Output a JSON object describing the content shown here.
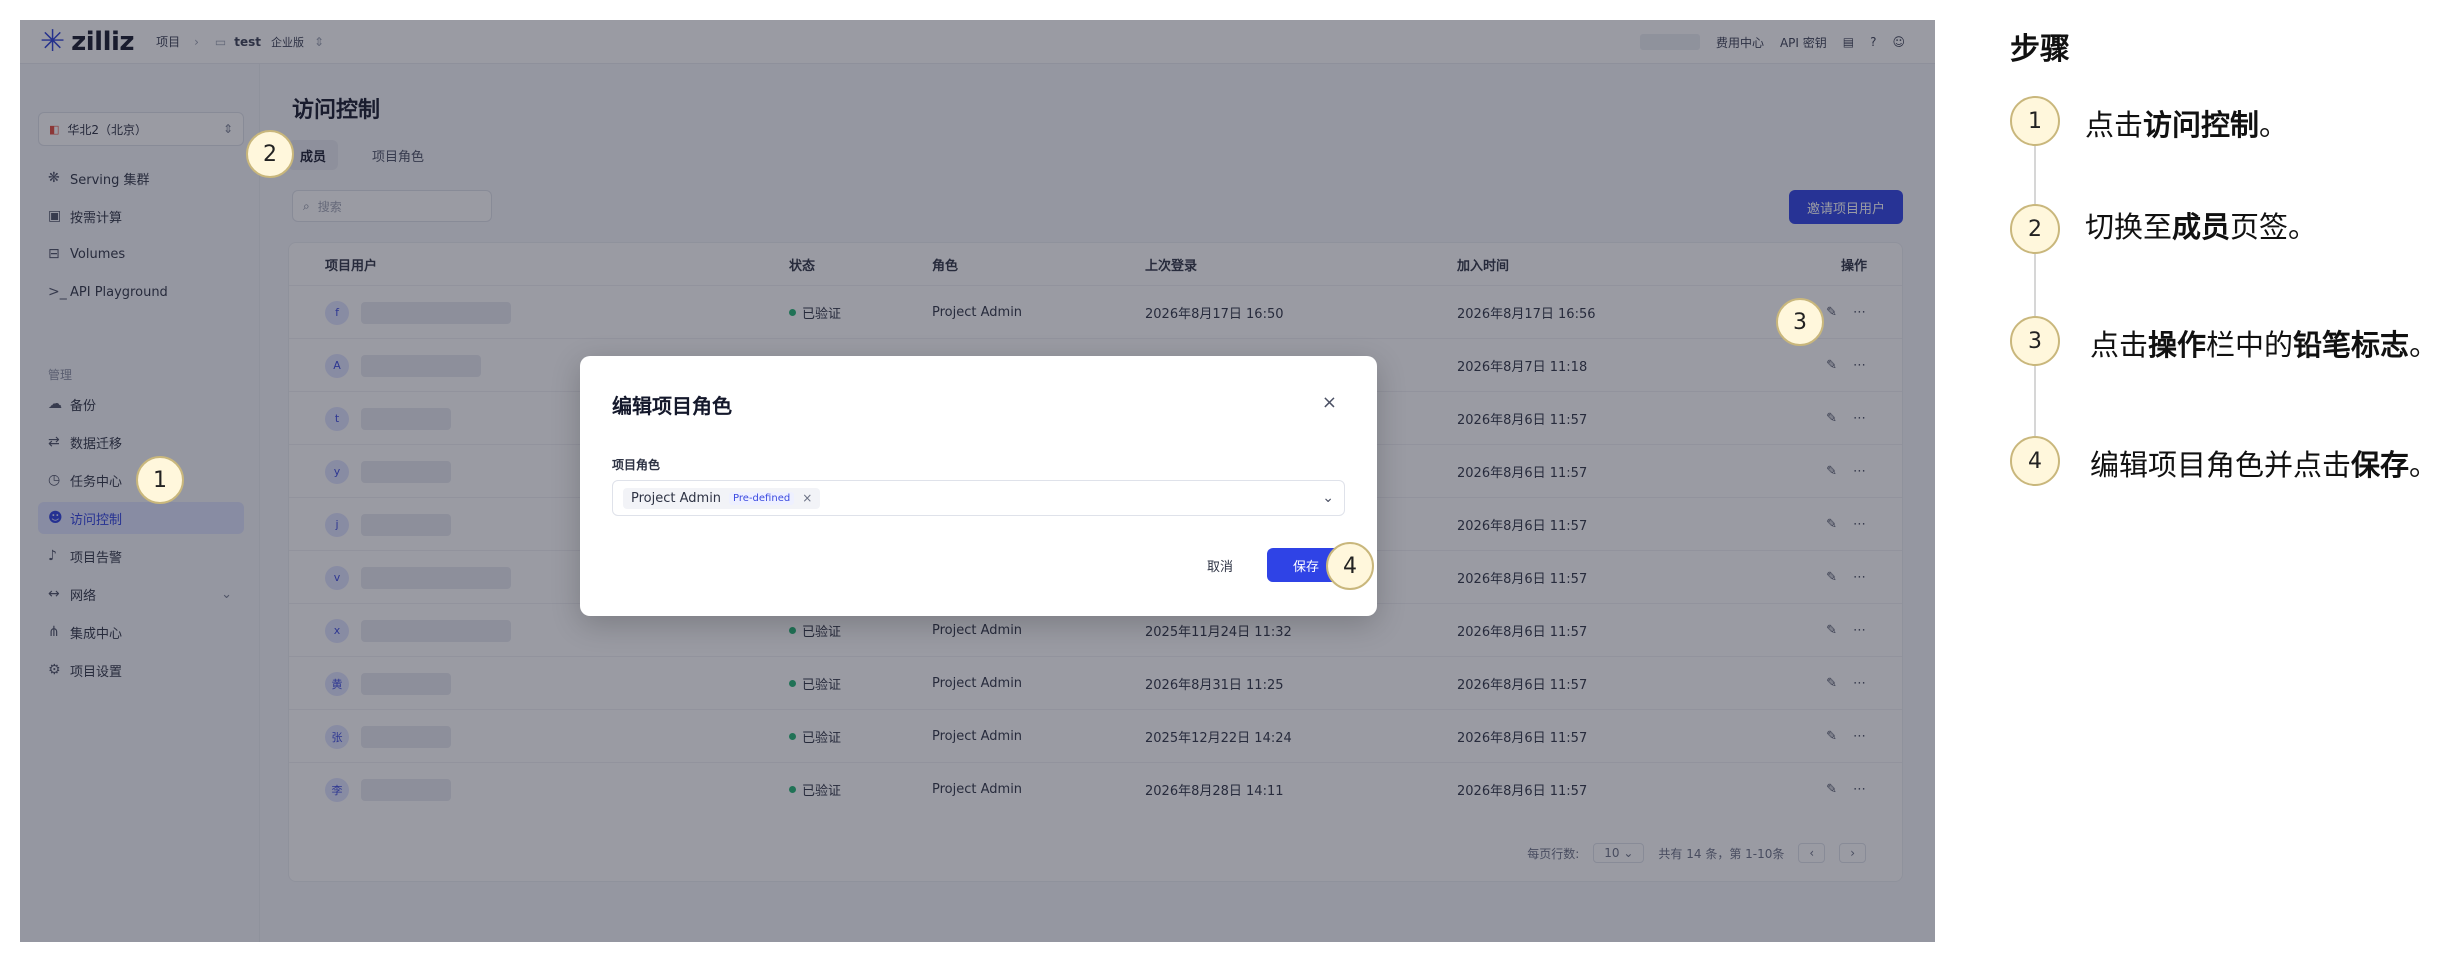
{
  "topbar": {
    "logo": "zilliz",
    "crumb_projects": "项目",
    "crumb_sep": "›",
    "project": "test",
    "edition": "企业版",
    "billing": "费用中心",
    "api_key": "API 密钥"
  },
  "sidebar": {
    "region": "华北2（北京）",
    "items": [
      {
        "label": "Serving 集群",
        "icon": "cluster-icon"
      },
      {
        "label": "按需计算",
        "icon": "compute-icon"
      },
      {
        "label": "Volumes",
        "icon": "volume-icon"
      },
      {
        "label": "API Playground",
        "icon": "terminal-icon"
      }
    ],
    "group_label": "管理",
    "manage_items": [
      {
        "label": "备份",
        "icon": "cloud-icon"
      },
      {
        "label": "数据迁移",
        "icon": "migrate-icon"
      },
      {
        "label": "任务中心",
        "icon": "history-icon"
      },
      {
        "label": "访问控制",
        "icon": "users-icon"
      },
      {
        "label": "项目告警",
        "icon": "bell-icon"
      },
      {
        "label": "网络",
        "icon": "network-icon"
      },
      {
        "label": "集成中心",
        "icon": "share-icon"
      },
      {
        "label": "项目设置",
        "icon": "settings-icon"
      }
    ]
  },
  "main": {
    "title": "访问控制",
    "tabs": [
      "成员",
      "项目角色"
    ],
    "search_placeholder": "搜索",
    "invite_button": "邀请项目用户",
    "columns": [
      "项目用户",
      "状态",
      "角色",
      "上次登录",
      "加入时间",
      "操作"
    ],
    "rows": [
      {
        "initial": "f",
        "status": "已验证",
        "role": "Project Admin",
        "last_login": "2026年8月17日 16:50",
        "joined": "2026年8月17日 16:56"
      },
      {
        "initial": "A",
        "status": "",
        "role": "",
        "last_login": "",
        "joined": "2026年8月7日 11:18"
      },
      {
        "initial": "t",
        "status": "",
        "role": "",
        "last_login": "",
        "joined": "2026年8月6日 11:57"
      },
      {
        "initial": "y",
        "status": "",
        "role": "",
        "last_login": "",
        "joined": "2026年8月6日 11:57"
      },
      {
        "initial": "j",
        "status": "",
        "role": "",
        "last_login": "",
        "joined": "2026年8月6日 11:57"
      },
      {
        "initial": "v",
        "status": "",
        "role": "",
        "last_login": "",
        "joined": "2026年8月6日 11:57"
      },
      {
        "initial": "x",
        "status": "已验证",
        "role": "Project Admin",
        "last_login": "2025年11月24日 11:32",
        "joined": "2026年8月6日 11:57"
      },
      {
        "initial": "黄",
        "status": "已验证",
        "role": "Project Admin",
        "last_login": "2026年8月31日 11:25",
        "joined": "2026年8月6日 11:57"
      },
      {
        "initial": "张",
        "status": "已验证",
        "role": "Project Admin",
        "last_login": "2025年12月22日 14:24",
        "joined": "2026年8月6日 11:57"
      },
      {
        "initial": "李",
        "status": "已验证",
        "role": "Project Admin",
        "last_login": "2026年8月28日 14:11",
        "joined": "2026年8月6日 11:57"
      }
    ],
    "pager_rows_label": "每页行数:",
    "pager_rows_value": "10",
    "pager_summary": "共有 14 条，第 1-10条"
  },
  "modal": {
    "title": "编辑项目角色",
    "field_label": "项目角色",
    "chip_label": "Project Admin",
    "chip_tag": "Pre-defined",
    "cancel": "取消",
    "save": "保存"
  },
  "callouts": [
    "1",
    "2",
    "3",
    "4"
  ],
  "steps": {
    "title": "步骤",
    "items": [
      {
        "num": "1",
        "pre": "点击",
        "bold": "访问控制",
        "post": "。",
        "bold2": "",
        "post2": ""
      },
      {
        "num": "2",
        "pre": "切换至",
        "bold": "成员",
        "post": "页签。",
        "bold2": "",
        "post2": ""
      },
      {
        "num": "3",
        "pre": "点击",
        "bold": "操作",
        "post": "栏中的",
        "bold2": "铅笔标志",
        "post2": "。"
      },
      {
        "num": "4",
        "pre": "编辑项目角色并点击",
        "bold": "保存",
        "post": "。",
        "bold2": "",
        "post2": ""
      }
    ]
  },
  "colors": {
    "accent": "#2f43e6",
    "callout_bg": "#fff7dc",
    "status_ok": "#22b573"
  }
}
